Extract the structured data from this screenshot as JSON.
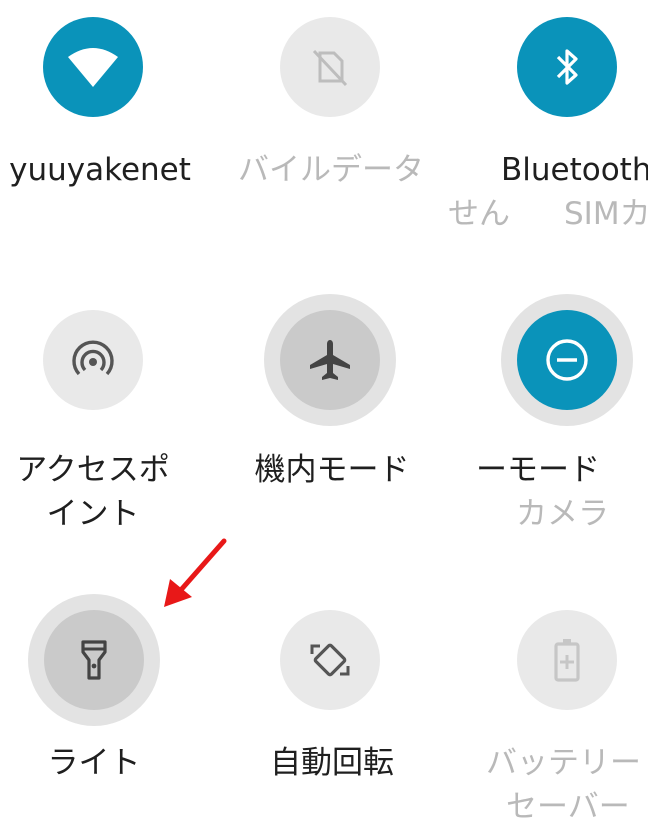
{
  "tiles": {
    "wifi": {
      "label": "yuuyakenet",
      "icon": "wifi-icon",
      "state": "on"
    },
    "mobile_data": {
      "label_line1": "バイルデータ",
      "label_line2a": "せん",
      "label_line2b": "SIMカ",
      "icon": "no-sim-icon",
      "state": "unavailable"
    },
    "bluetooth": {
      "label": "Bluetooth",
      "icon": "bluetooth-icon",
      "state": "on"
    },
    "hotspot": {
      "label_line1": "アクセスポ",
      "label_line2": "イント",
      "icon": "hotspot-icon",
      "state": "off"
    },
    "airplane": {
      "label": "機内モード",
      "icon": "airplane-icon",
      "state": "off"
    },
    "dnd": {
      "label_line1": "ーモード",
      "label_line2": "カメラ",
      "icon": "do-not-disturb-icon",
      "state": "on"
    },
    "flashlight": {
      "label": "ライト",
      "icon": "flashlight-icon",
      "state": "off"
    },
    "auto_rotate": {
      "label": "自動回転",
      "icon": "auto-rotate-icon",
      "state": "off"
    },
    "battery_saver": {
      "label_line1": "バッテリー",
      "label_line2": "セーバー",
      "icon": "battery-saver-icon",
      "state": "unavailable"
    }
  },
  "colors": {
    "accent": "#0a93ba",
    "arrow": "#e81818"
  }
}
